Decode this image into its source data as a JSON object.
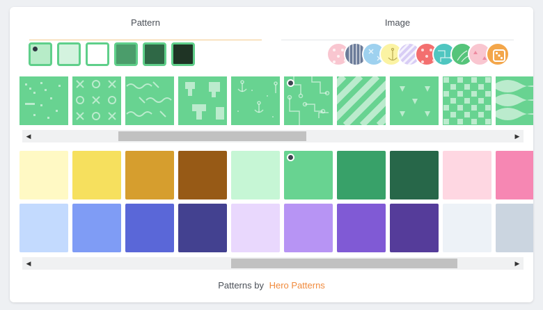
{
  "tabs": {
    "pattern": {
      "label": "Pattern",
      "active": true
    },
    "image": {
      "label": "Image",
      "active": false
    }
  },
  "shade_swatches": [
    {
      "color": "#b7ecc8",
      "selected": true
    },
    {
      "color": "#d4f3df",
      "selected": false
    },
    {
      "color": "#ffffff",
      "selected": false
    },
    {
      "color": "#4b9d6b",
      "selected": false
    },
    {
      "color": "#2f6846",
      "selected": false
    },
    {
      "color": "#1f3425",
      "selected": false
    }
  ],
  "image_presets": [
    {
      "color": "#f9c6d0",
      "icon": "dots-pattern-icon"
    },
    {
      "color": "#6b7b99",
      "icon": "stripes-pattern-icon"
    },
    {
      "color": "#9ed1ef",
      "icon": "x-pattern-icon"
    },
    {
      "color": "#fbf3a3",
      "icon": "anchor-pattern-icon"
    },
    {
      "color": "#d8cdf5",
      "icon": "diagonal-pattern-icon"
    },
    {
      "color": "#f36f6f",
      "icon": "dots-pattern-icon"
    },
    {
      "color": "#4fc6c0",
      "icon": "circuit-pattern-icon"
    },
    {
      "color": "#55c47a",
      "icon": "leaf-pattern-icon"
    },
    {
      "color": "#f9c6d0",
      "icon": "triangles-pattern-icon"
    },
    {
      "color": "#f3a64a",
      "icon": "dice-icon"
    }
  ],
  "patterns": [
    {
      "name": "tech-dots",
      "selected": false
    },
    {
      "name": "tic-tac-toe",
      "selected": false
    },
    {
      "name": "wiggle",
      "selected": false
    },
    {
      "name": "blobs",
      "selected": false
    },
    {
      "name": "anchors",
      "selected": false
    },
    {
      "name": "circuit-board",
      "selected": true
    },
    {
      "name": "diagonal-stripes",
      "selected": false
    },
    {
      "name": "triangles",
      "selected": false
    },
    {
      "name": "checkerboard",
      "selected": false
    },
    {
      "name": "waves",
      "selected": false
    }
  ],
  "palette_rows": [
    [
      "#fff9c4",
      "#f6e05e",
      "#d69e2e",
      "#975a16",
      "#c6f6d5",
      "#68d391",
      "#38a169",
      "#276749",
      "#fed7e2",
      "#f687b3"
    ],
    [
      "#c3dafe",
      "#7f9cf5",
      "#5a67d8",
      "#434190",
      "#e9d8fd",
      "#b794f4",
      "#805ad5",
      "#553c9a",
      "#edf2f7",
      "#cbd5e0"
    ]
  ],
  "selected_color": "#68d391",
  "pattern_color": "#68d391",
  "footer": {
    "prefix": "Patterns by",
    "link": "Hero Patterns",
    "link_color": "#f08a3c"
  }
}
